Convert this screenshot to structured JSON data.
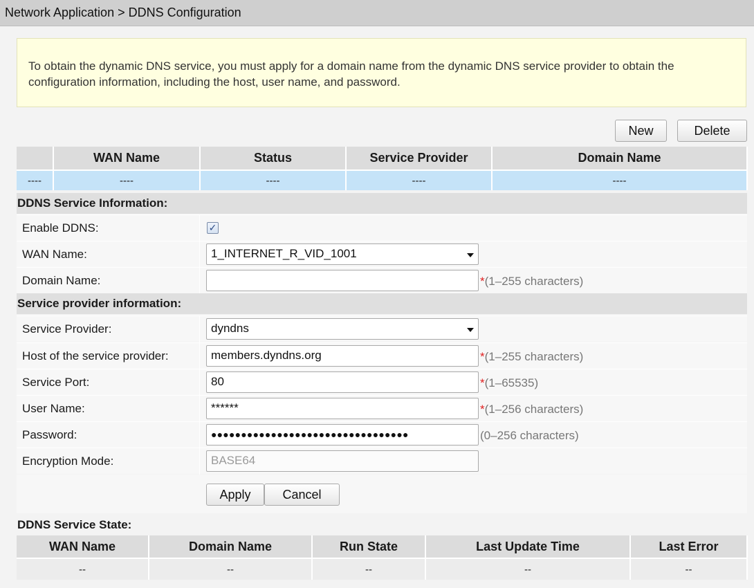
{
  "breadcrumb": "Network Application > DDNS Configuration",
  "notice": "To obtain the dynamic DNS service, you must apply for a domain name from the dynamic DNS service provider to obtain the configuration information, including the host, user name, and password.",
  "toolbar": {
    "new_label": "New",
    "delete_label": "Delete"
  },
  "wan_table": {
    "headers": [
      "",
      "WAN Name",
      "Status",
      "Service Provider",
      "Domain Name"
    ],
    "row": [
      "----",
      "----",
      "----",
      "----",
      "----"
    ]
  },
  "ddns_section": {
    "title": "DDNS Service Information:",
    "enable_label": "Enable DDNS:",
    "enable_checked": true,
    "wan_label": "WAN Name:",
    "wan_value": "1_INTERNET_R_VID_1001",
    "domain_label": "Domain Name:",
    "domain_value": "",
    "domain_hint": "(1–255 characters)"
  },
  "provider_section": {
    "title": "Service provider information:",
    "provider_label": "Service Provider:",
    "provider_value": "dyndns",
    "host_label": "Host of the service provider:",
    "host_value": "members.dyndns.org",
    "host_hint": "(1–255 characters)",
    "port_label": "Service Port:",
    "port_value": "80",
    "port_hint": "(1–65535)",
    "user_label": "User Name:",
    "user_value": "******",
    "user_hint": "(1–256 characters)",
    "password_label": "Password:",
    "password_value": "●●●●●●●●●●●●●●●●●●●●●●●●●●●●●●●●●",
    "password_hint": "(0–256 characters)",
    "encryption_label": "Encryption Mode:",
    "encryption_value": "BASE64"
  },
  "required_mark": "*",
  "checkbox_mark": "✓",
  "actions": {
    "apply_label": "Apply",
    "cancel_label": "Cancel"
  },
  "state_section": {
    "title": "DDNS Service State:",
    "headers": [
      "WAN Name",
      "Domain Name",
      "Run State",
      "Last Update Time",
      "Last Error"
    ],
    "row": [
      "--",
      "--",
      "--",
      "--",
      "--"
    ]
  }
}
